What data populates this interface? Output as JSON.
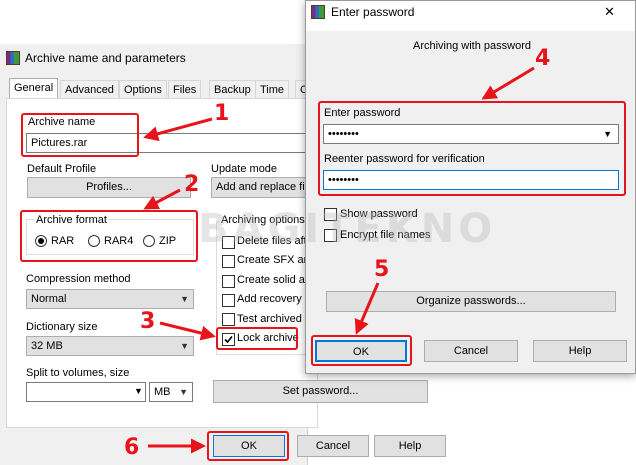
{
  "archive_dialog": {
    "title": "Archive name and parameters",
    "tabs": [
      "General",
      "Advanced",
      "Options",
      "Files",
      "Backup",
      "Time",
      "C"
    ],
    "archive_name_label": "Archive name",
    "archive_name_value": "Pictures.rar",
    "default_profile_label": "Default Profile",
    "profiles_button": "Profiles...",
    "update_mode_label": "Update mode",
    "update_mode_value": "Add and replace files",
    "archive_format_label": "Archive format",
    "formats": [
      "RAR",
      "RAR4",
      "ZIP"
    ],
    "selected_format": "RAR",
    "compression_method_label": "Compression method",
    "compression_method_value": "Normal",
    "dictionary_size_label": "Dictionary size",
    "dictionary_size_value": "32 MB",
    "split_label": "Split to volumes, size",
    "split_value": "",
    "split_unit": "MB",
    "archiving_options_label": "Archiving options",
    "options": [
      {
        "label": "Delete files after archiving",
        "checked": false
      },
      {
        "label": "Create SFX archive",
        "checked": false
      },
      {
        "label": "Create solid archive",
        "checked": false
      },
      {
        "label": "Add recovery record",
        "checked": false
      },
      {
        "label": "Test archived files",
        "checked": false
      },
      {
        "label": "Lock archive",
        "checked": true
      }
    ],
    "set_password_button": "Set password...",
    "ok_button": "OK",
    "cancel_button": "Cancel",
    "help_button": "Help"
  },
  "password_dialog": {
    "title": "Enter password",
    "close_glyph": "✕",
    "subtitle": "Archiving with password",
    "enter_password_label": "Enter password",
    "password_value": "••••••••",
    "reenter_label": "Reenter password for verification",
    "reenter_value": "••••••••",
    "show_password_label": "Show password",
    "encrypt_names_label": "Encrypt file names",
    "organize_button": "Organize passwords...",
    "ok_button": "OK",
    "cancel_button": "Cancel",
    "help_button": "Help"
  },
  "annotations": [
    "1",
    "2",
    "3",
    "4",
    "5",
    "6"
  ],
  "watermark": "BAGITEKNO",
  "colors": {
    "annotation_red": "#e8141b",
    "focus_blue": "#0078d7",
    "dialog_bg": "#f0f0f0"
  }
}
